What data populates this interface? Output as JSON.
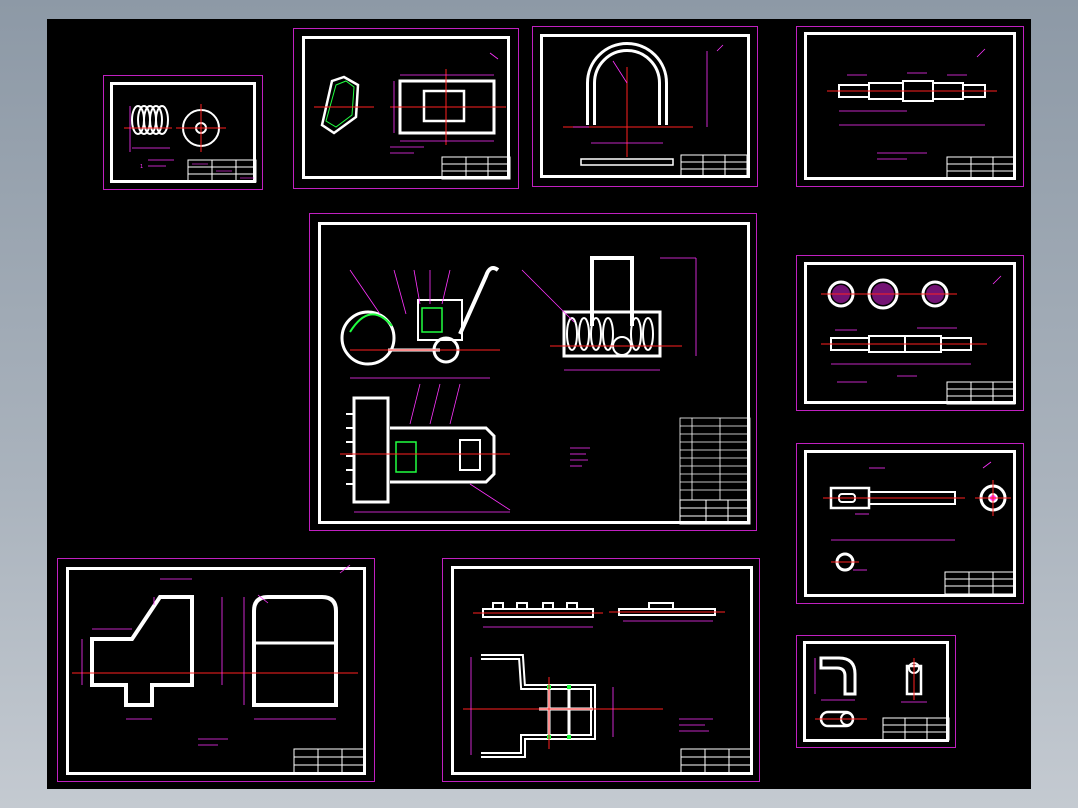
{
  "viewer": {
    "background_gradient": [
      "#8d99a6",
      "#c4cad1"
    ],
    "canvas_color": "#000000"
  },
  "colors": {
    "frame": "#ffffff",
    "sheet_border": "#c020c0",
    "dimension": "#ff33ff",
    "centerline": "#ff2020",
    "highlight": "#20ff40",
    "construction": "#4040ff"
  },
  "sheets": [
    {
      "id": "small-spring-part"
    },
    {
      "id": "bracket-part"
    },
    {
      "id": "u-handle-part"
    },
    {
      "id": "shaft-part-1"
    },
    {
      "id": "main-assembly"
    },
    {
      "id": "shaft-part-2"
    },
    {
      "id": "axle-part"
    },
    {
      "id": "side-plate-part"
    },
    {
      "id": "frame-part"
    },
    {
      "id": "elbow-part"
    }
  ],
  "annotations": {
    "sheet1_balloon": "1"
  }
}
